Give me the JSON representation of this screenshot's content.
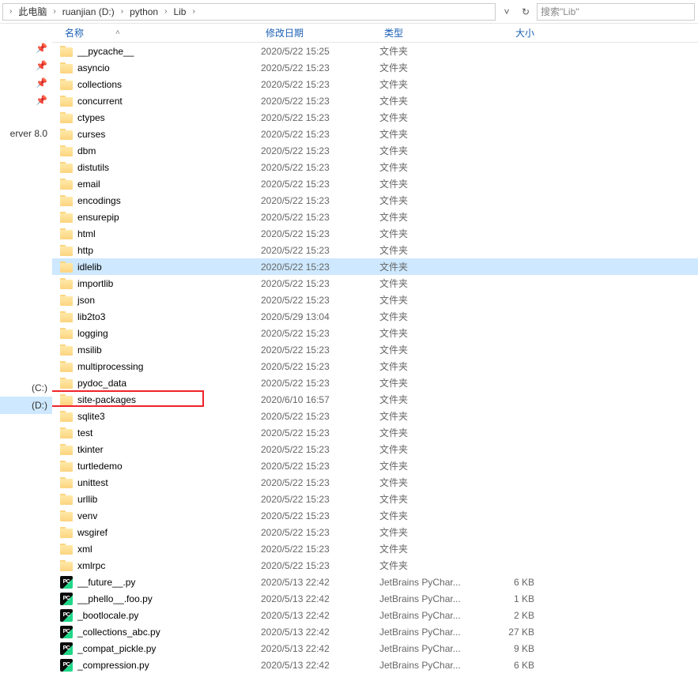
{
  "breadcrumbs": [
    "此电脑",
    "ruanjian (D:)",
    "python",
    "Lib"
  ],
  "search_placeholder": "搜索\"Lib\"",
  "sidebar": {
    "label_server": "erver 8.0",
    "c_drive": "(C:)",
    "d_drive": "(D:)"
  },
  "columns": {
    "name": "名称",
    "modified": "修改日期",
    "type": "类型",
    "size": "大小"
  },
  "rows": [
    {
      "name": "__pycache__",
      "mod": "2020/5/22 15:25",
      "type": "文件夹",
      "size": "",
      "kind": "folder"
    },
    {
      "name": "asyncio",
      "mod": "2020/5/22 15:23",
      "type": "文件夹",
      "size": "",
      "kind": "folder"
    },
    {
      "name": "collections",
      "mod": "2020/5/22 15:23",
      "type": "文件夹",
      "size": "",
      "kind": "folder"
    },
    {
      "name": "concurrent",
      "mod": "2020/5/22 15:23",
      "type": "文件夹",
      "size": "",
      "kind": "folder"
    },
    {
      "name": "ctypes",
      "mod": "2020/5/22 15:23",
      "type": "文件夹",
      "size": "",
      "kind": "folder"
    },
    {
      "name": "curses",
      "mod": "2020/5/22 15:23",
      "type": "文件夹",
      "size": "",
      "kind": "folder"
    },
    {
      "name": "dbm",
      "mod": "2020/5/22 15:23",
      "type": "文件夹",
      "size": "",
      "kind": "folder"
    },
    {
      "name": "distutils",
      "mod": "2020/5/22 15:23",
      "type": "文件夹",
      "size": "",
      "kind": "folder"
    },
    {
      "name": "email",
      "mod": "2020/5/22 15:23",
      "type": "文件夹",
      "size": "",
      "kind": "folder"
    },
    {
      "name": "encodings",
      "mod": "2020/5/22 15:23",
      "type": "文件夹",
      "size": "",
      "kind": "folder"
    },
    {
      "name": "ensurepip",
      "mod": "2020/5/22 15:23",
      "type": "文件夹",
      "size": "",
      "kind": "folder"
    },
    {
      "name": "html",
      "mod": "2020/5/22 15:23",
      "type": "文件夹",
      "size": "",
      "kind": "folder"
    },
    {
      "name": "http",
      "mod": "2020/5/22 15:23",
      "type": "文件夹",
      "size": "",
      "kind": "folder"
    },
    {
      "name": "idlelib",
      "mod": "2020/5/22 15:23",
      "type": "文件夹",
      "size": "",
      "kind": "folder",
      "hl": true
    },
    {
      "name": "importlib",
      "mod": "2020/5/22 15:23",
      "type": "文件夹",
      "size": "",
      "kind": "folder"
    },
    {
      "name": "json",
      "mod": "2020/5/22 15:23",
      "type": "文件夹",
      "size": "",
      "kind": "folder"
    },
    {
      "name": "lib2to3",
      "mod": "2020/5/29 13:04",
      "type": "文件夹",
      "size": "",
      "kind": "folder"
    },
    {
      "name": "logging",
      "mod": "2020/5/22 15:23",
      "type": "文件夹",
      "size": "",
      "kind": "folder"
    },
    {
      "name": "msilib",
      "mod": "2020/5/22 15:23",
      "type": "文件夹",
      "size": "",
      "kind": "folder"
    },
    {
      "name": "multiprocessing",
      "mod": "2020/5/22 15:23",
      "type": "文件夹",
      "size": "",
      "kind": "folder"
    },
    {
      "name": "pydoc_data",
      "mod": "2020/5/22 15:23",
      "type": "文件夹",
      "size": "",
      "kind": "folder"
    },
    {
      "name": "site-packages",
      "mod": "2020/6/10 16:57",
      "type": "文件夹",
      "size": "",
      "kind": "folder",
      "boxed": true
    },
    {
      "name": "sqlite3",
      "mod": "2020/5/22 15:23",
      "type": "文件夹",
      "size": "",
      "kind": "folder"
    },
    {
      "name": "test",
      "mod": "2020/5/22 15:23",
      "type": "文件夹",
      "size": "",
      "kind": "folder"
    },
    {
      "name": "tkinter",
      "mod": "2020/5/22 15:23",
      "type": "文件夹",
      "size": "",
      "kind": "folder"
    },
    {
      "name": "turtledemo",
      "mod": "2020/5/22 15:23",
      "type": "文件夹",
      "size": "",
      "kind": "folder"
    },
    {
      "name": "unittest",
      "mod": "2020/5/22 15:23",
      "type": "文件夹",
      "size": "",
      "kind": "folder"
    },
    {
      "name": "urllib",
      "mod": "2020/5/22 15:23",
      "type": "文件夹",
      "size": "",
      "kind": "folder"
    },
    {
      "name": "venv",
      "mod": "2020/5/22 15:23",
      "type": "文件夹",
      "size": "",
      "kind": "folder"
    },
    {
      "name": "wsgiref",
      "mod": "2020/5/22 15:23",
      "type": "文件夹",
      "size": "",
      "kind": "folder"
    },
    {
      "name": "xml",
      "mod": "2020/5/22 15:23",
      "type": "文件夹",
      "size": "",
      "kind": "folder"
    },
    {
      "name": "xmlrpc",
      "mod": "2020/5/22 15:23",
      "type": "文件夹",
      "size": "",
      "kind": "folder"
    },
    {
      "name": "__future__.py",
      "mod": "2020/5/13 22:42",
      "type": "JetBrains PyChar...",
      "size": "6 KB",
      "kind": "py"
    },
    {
      "name": "__phello__.foo.py",
      "mod": "2020/5/13 22:42",
      "type": "JetBrains PyChar...",
      "size": "1 KB",
      "kind": "py"
    },
    {
      "name": "_bootlocale.py",
      "mod": "2020/5/13 22:42",
      "type": "JetBrains PyChar...",
      "size": "2 KB",
      "kind": "py"
    },
    {
      "name": "_collections_abc.py",
      "mod": "2020/5/13 22:42",
      "type": "JetBrains PyChar...",
      "size": "27 KB",
      "kind": "py"
    },
    {
      "name": "_compat_pickle.py",
      "mod": "2020/5/13 22:42",
      "type": "JetBrains PyChar...",
      "size": "9 KB",
      "kind": "py"
    },
    {
      "name": "_compression.py",
      "mod": "2020/5/13 22:42",
      "type": "JetBrains PyChar...",
      "size": "6 KB",
      "kind": "py"
    }
  ]
}
